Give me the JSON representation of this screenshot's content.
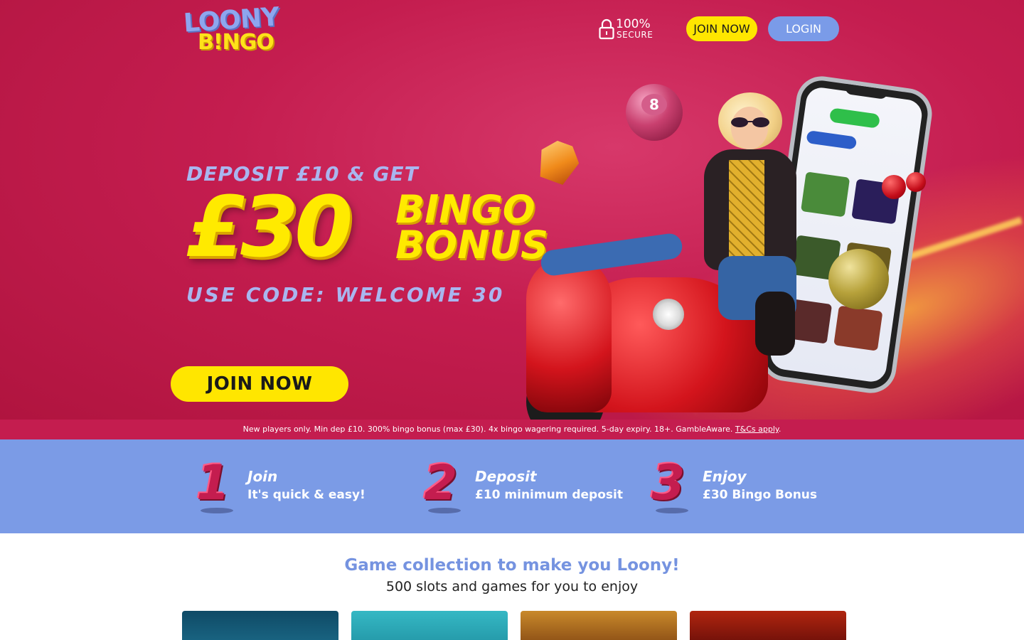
{
  "header": {
    "logo_line1": "LOONY",
    "logo_line2": "B!NGO",
    "secure_percent": "100%",
    "secure_label": "SECURE",
    "join_label": "JOIN NOW",
    "login_label": "LOGIN"
  },
  "hero": {
    "line1": "DEPOSIT £10 & GET",
    "amount": "£30",
    "bonus_line1": "BINGO",
    "bonus_line2": "BONUS",
    "code_line": "USE CODE: WELCOME 30",
    "cta_label": "JOIN NOW",
    "ball_number": "8"
  },
  "disclaimer": {
    "text": "New players only. Min dep £10. 300% bingo bonus (max £30). 4x bingo wagering required. 5-day expiry. 18+. GambleAware. ",
    "link": "T&Cs apply",
    "tail": "."
  },
  "steps": [
    {
      "number": "1",
      "title": "Join",
      "subtitle": "It's quick & easy!"
    },
    {
      "number": "2",
      "title": "Deposit",
      "subtitle": "£10 minimum deposit"
    },
    {
      "number": "3",
      "title": "Enjoy",
      "subtitle": "£30 Bingo Bonus"
    }
  ],
  "games": {
    "heading": "Game collection to make you Loony!",
    "subheading": "500 slots and games for you to enjoy"
  },
  "colors": {
    "brand_red": "#c41d4f",
    "step_blue": "#7b9be6",
    "cta_yellow": "#ffe600",
    "login_blue": "#7a9be8"
  }
}
